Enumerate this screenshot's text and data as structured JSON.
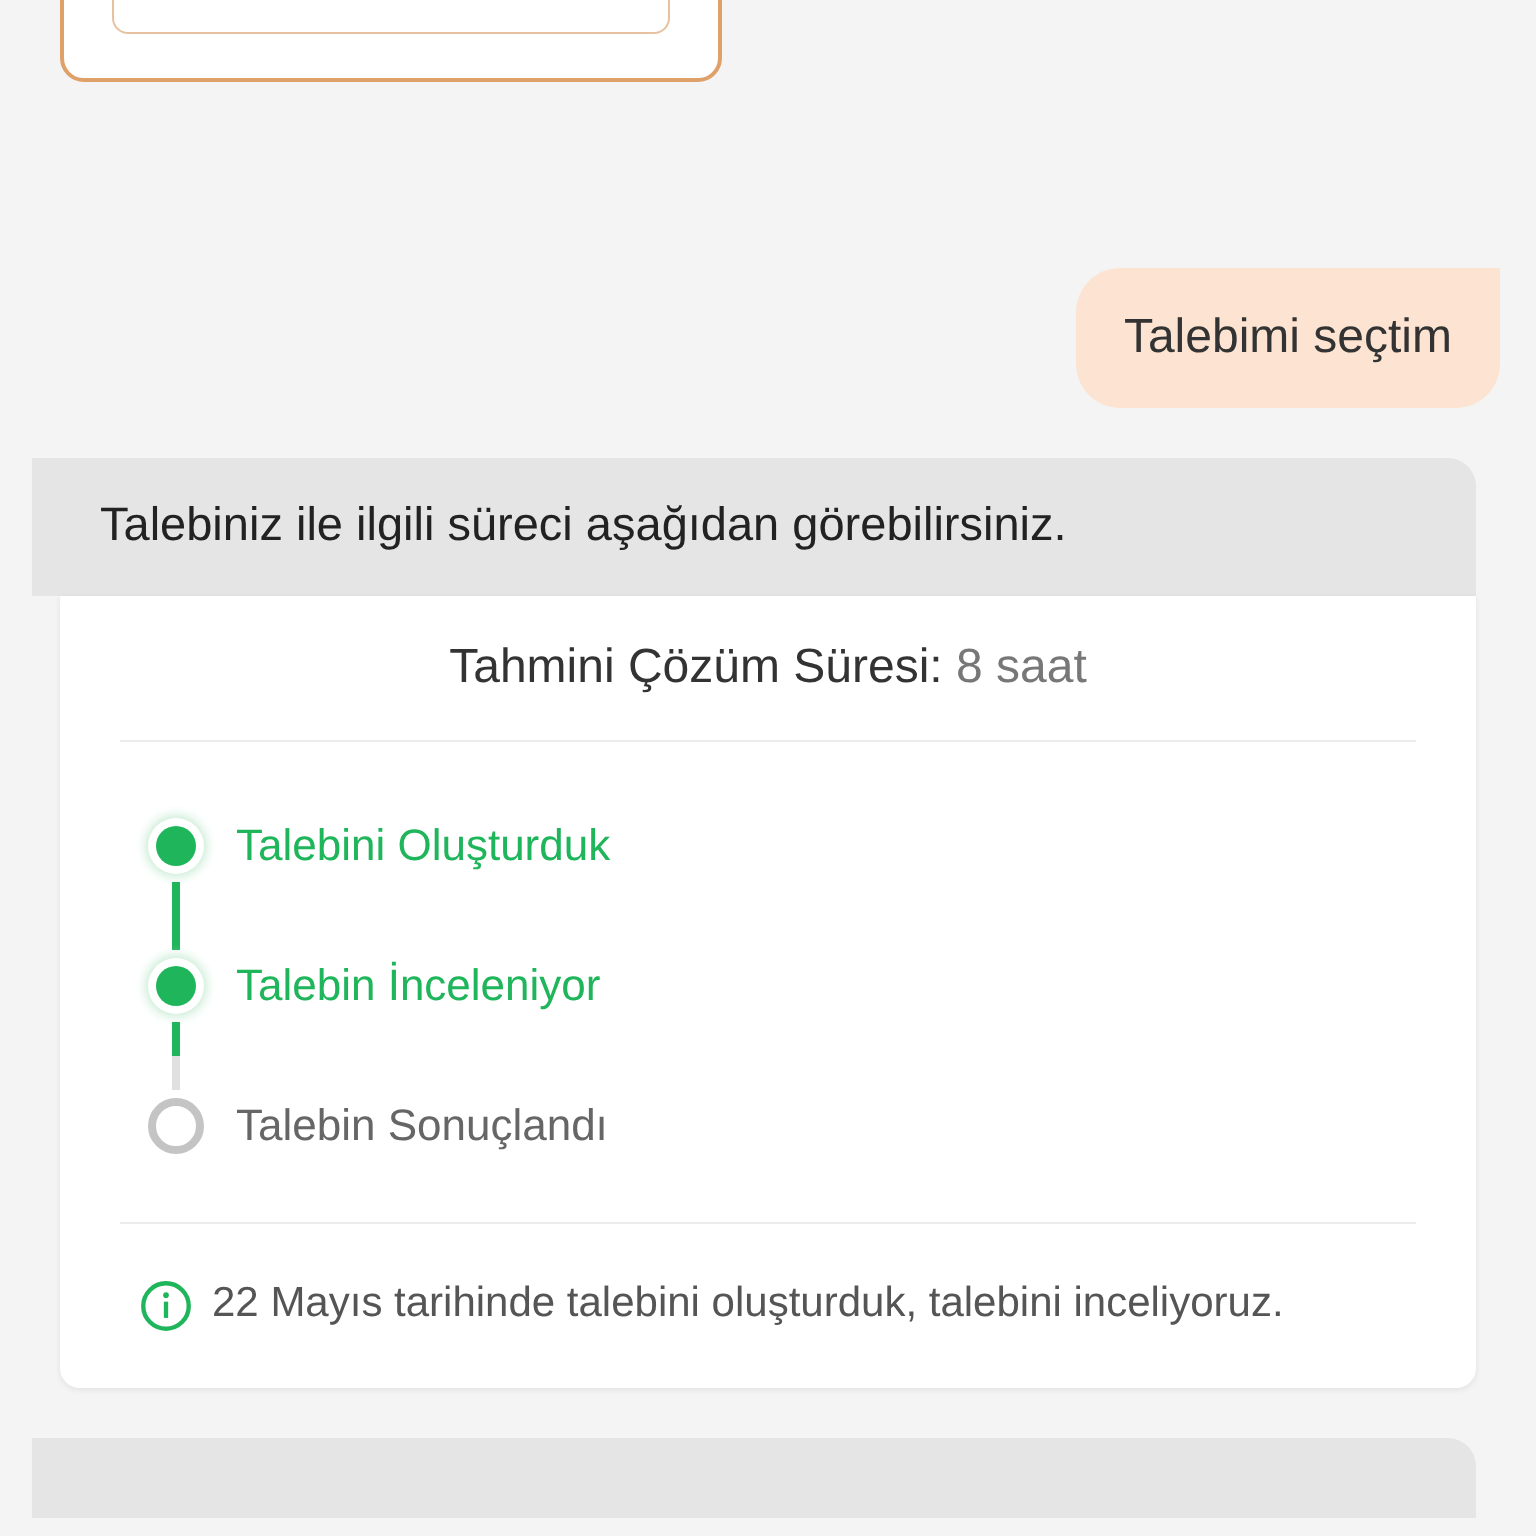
{
  "user_message": {
    "text": "Talebimi seçtim"
  },
  "bot_message": {
    "text": "Talebiniz ile ilgili süreci aşağıdan görebilirsiniz.",
    "estimate_label": "Tahmini Çözüm Süresi:",
    "estimate_value": "8 saat",
    "steps": [
      {
        "label": "Talebini Oluşturduk",
        "done": true
      },
      {
        "label": "Talebin İnceleniyor",
        "done": true
      },
      {
        "label": "Talebin Sonuçlandı",
        "done": false
      }
    ],
    "info": "22 Mayıs tarihinde talebini oluşturduk, talebini inceliyoruz."
  }
}
